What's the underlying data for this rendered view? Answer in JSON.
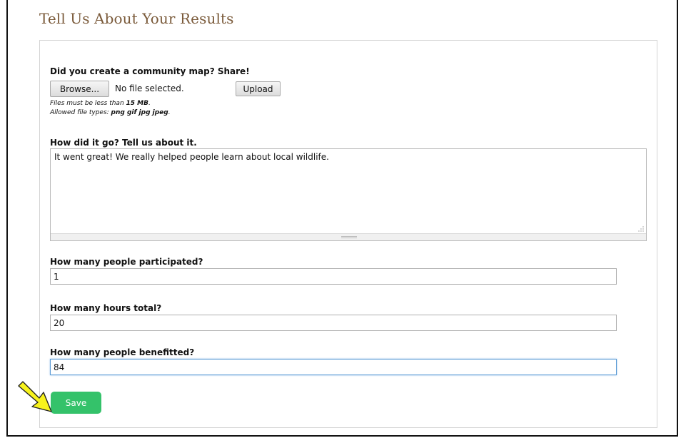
{
  "page": {
    "title": "Tell Us About Your Results"
  },
  "upload": {
    "label": "Did you create a community map? Share!",
    "browse_label": "Browse...",
    "file_status": "No file selected.",
    "upload_label": "Upload",
    "size_hint_prefix": "Files must be less than ",
    "size_hint_value": "15 MB",
    "size_hint_suffix": ".",
    "types_hint_prefix": "Allowed file types: ",
    "types_hint_value": "png gif jpg jpeg",
    "types_hint_suffix": "."
  },
  "story": {
    "label": "How did it go? Tell us about it.",
    "value": "It went great! We really helped people learn about local wildlife."
  },
  "participants": {
    "label": "How many people participated?",
    "value": "1"
  },
  "hours": {
    "label": "How many hours total?",
    "value": "20"
  },
  "benefitted": {
    "label": "How many people benefitted?",
    "value": "84"
  },
  "actions": {
    "save_label": "Save"
  },
  "colors": {
    "title": "#7a5a3a",
    "save_button": "#34c26a",
    "arrow_fill": "#f7f21c",
    "focus_border": "#5b9bd5"
  },
  "icons": {
    "annotation": "pointer-arrow-icon"
  }
}
